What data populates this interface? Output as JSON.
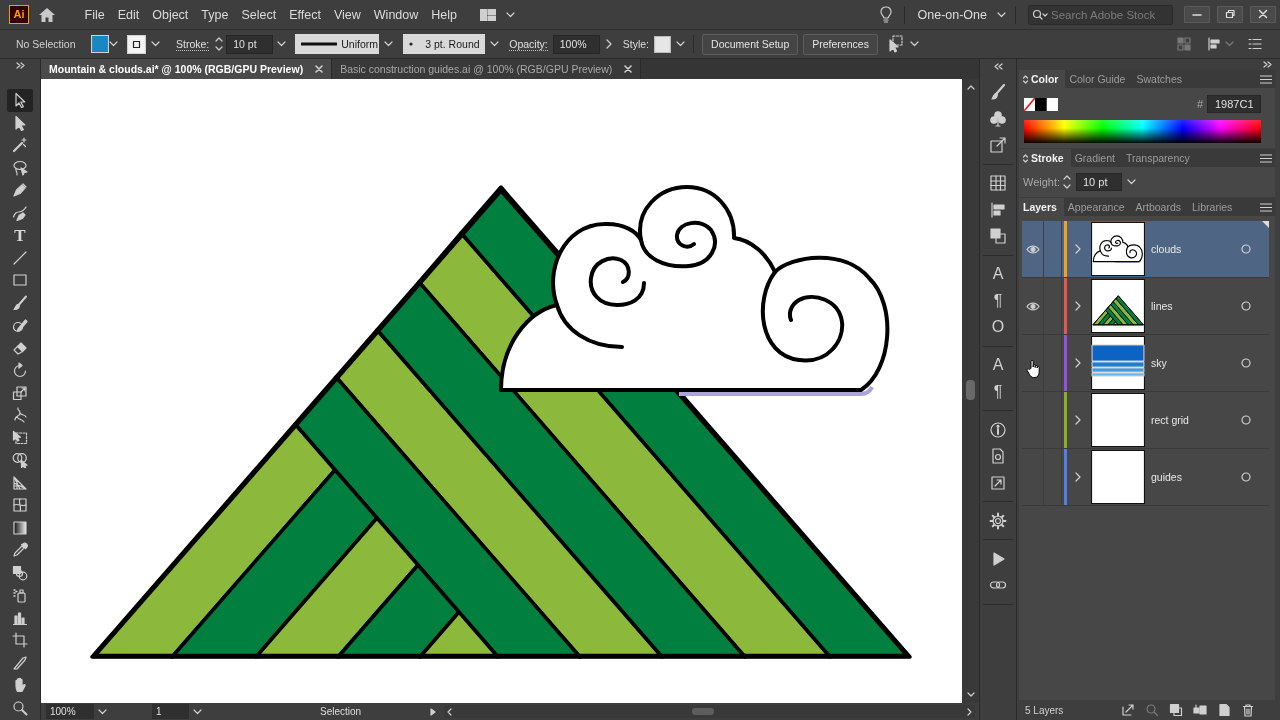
{
  "app_bar": {
    "logo": "Ai",
    "menus": [
      "File",
      "Edit",
      "Object",
      "Type",
      "Select",
      "Effect",
      "View",
      "Window",
      "Help"
    ],
    "workspace": "One-on-One",
    "search": {
      "placeholder": "Search Adobe Stock"
    }
  },
  "control_bar": {
    "selection": "No Selection",
    "stroke_label": "Stroke:",
    "stroke_weight": "10 pt",
    "profile": "Uniform",
    "brush": "3 pt. Round",
    "opacity_label": "Opacity:",
    "opacity": "100%",
    "style_label": "Style:",
    "buttons": [
      "Document Setup",
      "Preferences"
    ]
  },
  "tabs": [
    {
      "label": "Mountain & clouds.ai* @ 100% (RGB/GPU Preview)",
      "selected": true
    },
    {
      "label": "Basic construction guides.ai @ 100% (RGB/GPU Preview)",
      "selected": false
    }
  ],
  "tools": [
    {
      "selected": true
    },
    {
      "selected": false
    },
    {
      "selected": false
    },
    {
      "selected": false
    },
    {
      "selected": false
    },
    {
      "selected": false
    },
    {
      "selected": false,
      "glyph": "T"
    },
    {
      "selected": false
    },
    {
      "selected": false
    },
    {
      "selected": false
    },
    {
      "selected": false
    },
    {
      "selected": false
    },
    {
      "selected": false
    },
    {
      "selected": false
    },
    {
      "selected": false
    },
    {
      "selected": false
    },
    {
      "selected": false
    },
    {
      "selected": false
    },
    {
      "selected": false
    },
    {
      "selected": false
    },
    {
      "selected": false
    },
    {
      "selected": false
    },
    {
      "selected": false
    },
    {
      "selected": false
    },
    {
      "selected": false
    },
    {
      "selected": false
    },
    {
      "selected": false
    },
    {
      "selected": false
    }
  ],
  "dock_glyphs": [
    "A",
    "¶",
    "O",
    "A",
    "¶"
  ],
  "color_panel": {
    "tabs": [
      {
        "label": "Color",
        "selected": true
      },
      {
        "label": "Color Guide",
        "selected": false
      },
      {
        "label": "Swatches",
        "selected": false
      }
    ],
    "hex_label": "#",
    "hex": "1987C1"
  },
  "stroke_panel": {
    "tabs": [
      {
        "label": "Stroke",
        "selected": true
      },
      {
        "label": "Gradient",
        "selected": false
      },
      {
        "label": "Transparency",
        "selected": false
      }
    ],
    "weight_label": "Weight:",
    "weight": "10 pt"
  },
  "layers_panel": {
    "tabs": [
      {
        "label": "Layers",
        "selected": true
      },
      {
        "label": "Appearance",
        "selected": false
      },
      {
        "label": "Artboards",
        "selected": false
      },
      {
        "label": "Libraries",
        "selected": false
      }
    ],
    "layers": [
      {
        "name": "clouds",
        "visible": true,
        "selected": true,
        "hovered": false,
        "color": "#f2a31b"
      },
      {
        "name": "lines",
        "visible": true,
        "selected": false,
        "hovered": false,
        "color": "#e5584a"
      },
      {
        "name": "sky",
        "visible": false,
        "selected": false,
        "hovered": true,
        "color": "#9152e0"
      },
      {
        "name": "rect grid",
        "visible": false,
        "selected": false,
        "hovered": false,
        "color": "#8fae1f"
      },
      {
        "name": "guides",
        "visible": false,
        "selected": false,
        "hovered": false,
        "color": "#4f7fe8"
      }
    ],
    "count": "5 Layers"
  },
  "status_bar": {
    "zoom": "100%",
    "artboard": "1",
    "tool": "Selection"
  }
}
